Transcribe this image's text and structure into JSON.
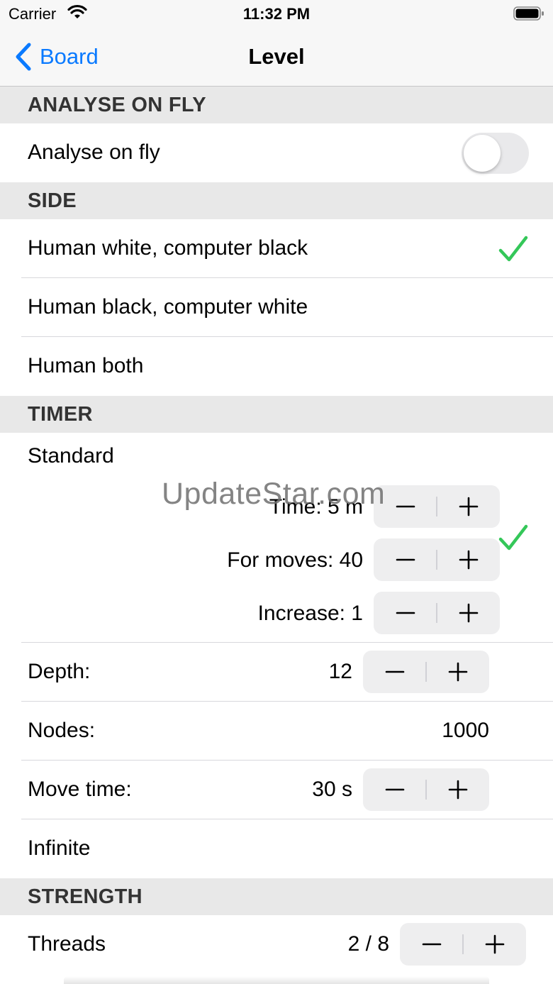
{
  "status_bar": {
    "carrier": "Carrier",
    "time": "11:32 PM"
  },
  "nav": {
    "back_label": "Board",
    "title": "Level"
  },
  "sections": {
    "analyse": {
      "header": "ANALYSE ON FLY",
      "row_label": "Analyse on fly",
      "toggle_on": false
    },
    "side": {
      "header": "SIDE",
      "options": [
        "Human white, computer black",
        "Human black, computer white",
        "Human both"
      ],
      "selected_index": 0
    },
    "timer": {
      "header": "TIMER",
      "standard_label": "Standard",
      "standard_selected": true,
      "time_value": "Time: 5 m",
      "moves_value": "For moves: 40",
      "increase_value": "Increase: 1",
      "depth_label": "Depth:",
      "depth_value": "12",
      "nodes_label": "Nodes:",
      "nodes_value": "1000",
      "move_time_label": "Move time:",
      "move_time_value": "30 s",
      "infinite_label": "Infinite"
    },
    "strength": {
      "header": "STRENGTH",
      "threads_label": "Threads",
      "threads_value": "2 / 8"
    }
  },
  "watermark": "UpdateStar.com",
  "colors": {
    "accent": "#0a7aff",
    "check": "#34c759",
    "section_bg": "#e8e8e8",
    "toggle_off": "#e9e9eb"
  }
}
